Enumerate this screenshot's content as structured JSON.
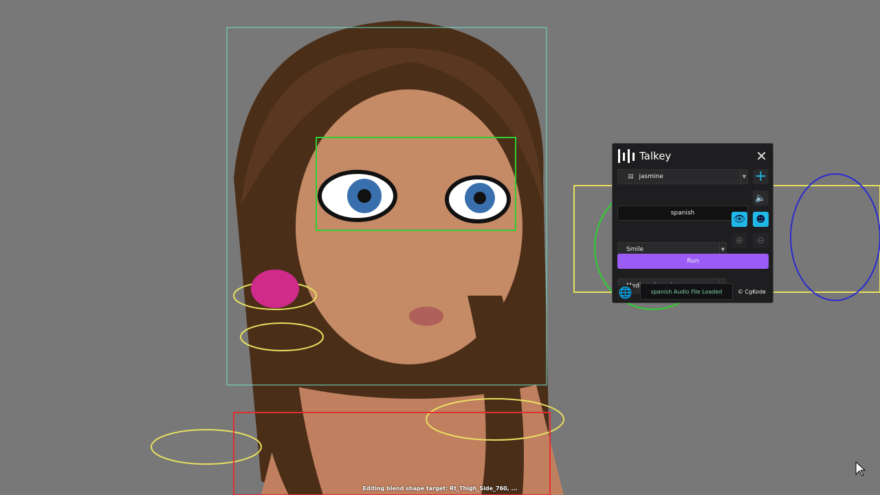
{
  "viewport": {
    "status_text": "Editing blend shape target: Rt_Thigh_Side_760, ..."
  },
  "panel": {
    "title": "Talkey",
    "character": "jasmine",
    "language": "spanish",
    "expression": "Smile",
    "speed": "Medium Speed",
    "run_label": "Run",
    "status": "spanish Audio File Loaded",
    "credit": "© CgKode",
    "colors": {
      "accent": "#9b5cf5",
      "cyan": "#1fb8e8",
      "speaker": "#c0394f",
      "status_text": "#7ed0a0"
    }
  }
}
